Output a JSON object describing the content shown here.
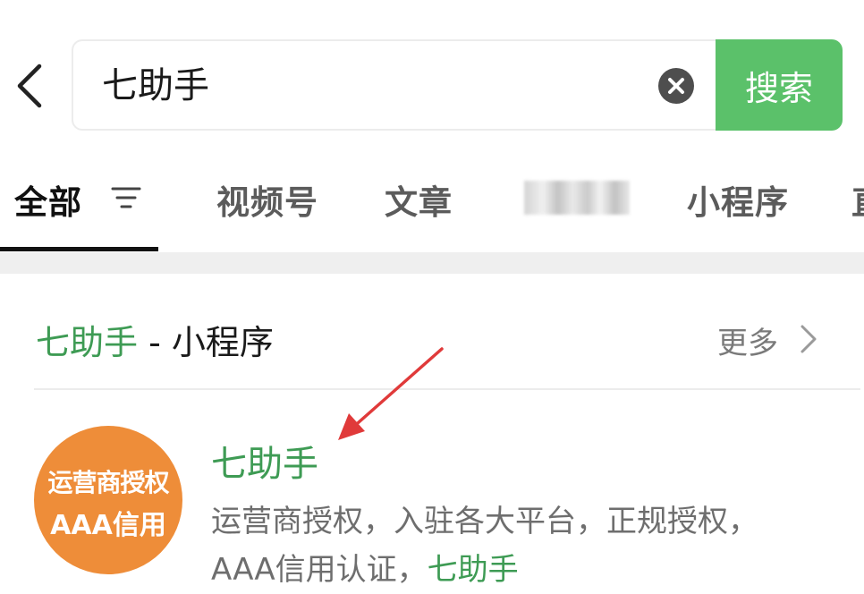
{
  "search": {
    "query": "七助手",
    "button_label": "搜索"
  },
  "tabs": [
    {
      "label": "全部"
    },
    {
      "label": "视频号"
    },
    {
      "label": "文章"
    },
    {
      "label": ""
    },
    {
      "label": "小程序"
    },
    {
      "label": "直"
    }
  ],
  "section": {
    "title_highlight": "七助手",
    "title_rest": " - 小程序",
    "more_label": "更多"
  },
  "result": {
    "name": "七助手",
    "logo_line1": "运营商授权",
    "logo_line2": "AAA信用",
    "desc_text": "运营商授权，入驻各大平台，正规授权，AAA信用认证，",
    "desc_highlight": "七助手"
  },
  "colors": {
    "accent_green": "#5bc16a",
    "highlight_green": "#3e9b54",
    "logo_orange": "#ee8d39",
    "annotation_red": "#e03a3a"
  }
}
